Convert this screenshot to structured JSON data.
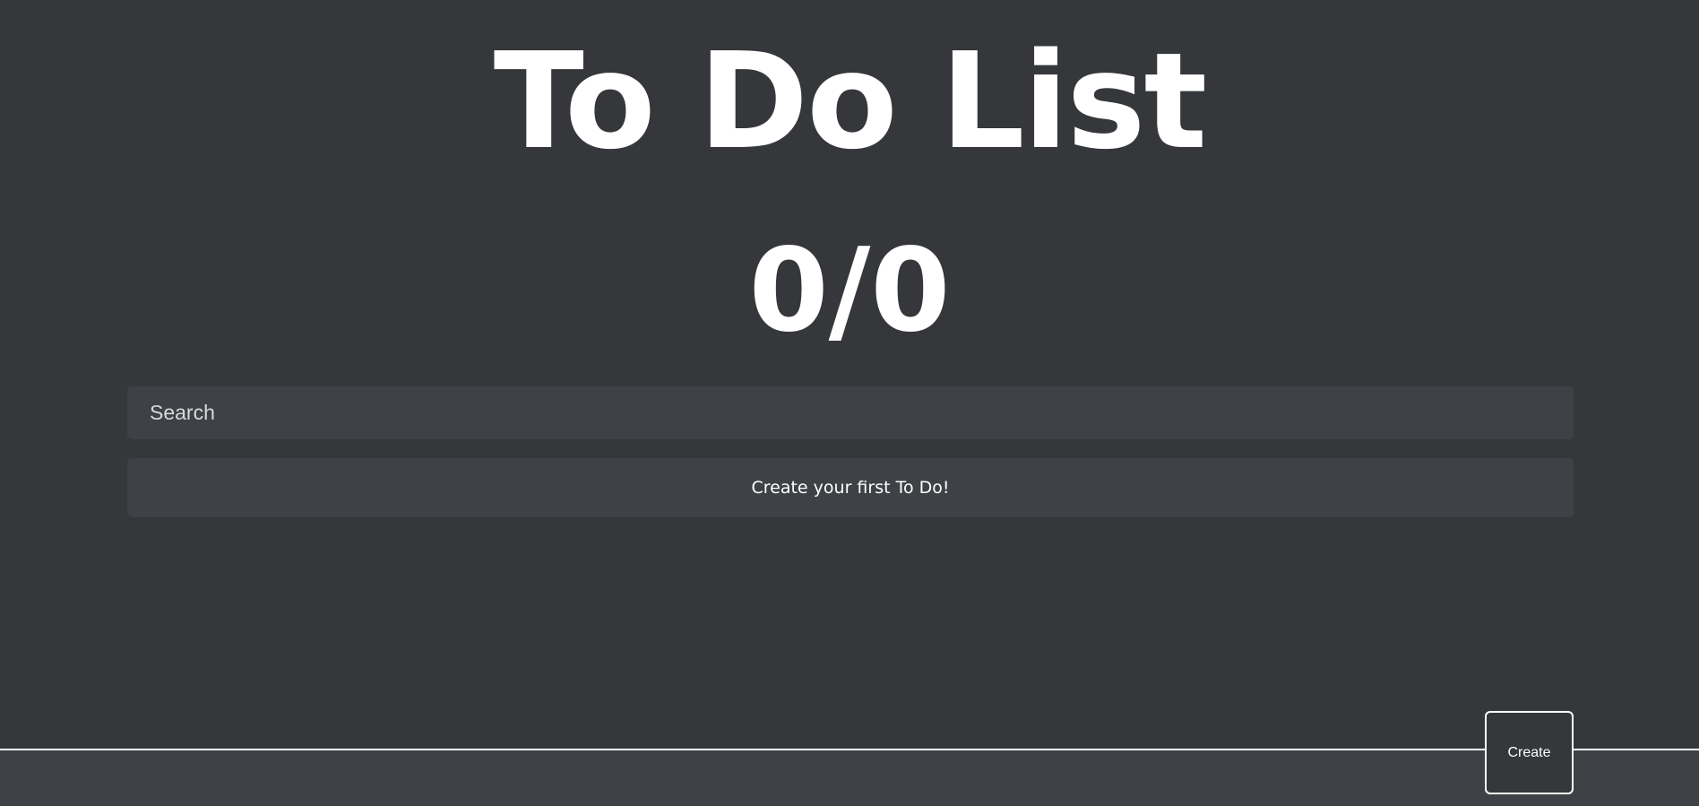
{
  "header": {
    "title": "To Do List",
    "counter": "0/0"
  },
  "search": {
    "placeholder": "Search",
    "value": ""
  },
  "list": {
    "empty_message": "Create your first To Do!"
  },
  "footer": {
    "create_label": "Create"
  },
  "colors": {
    "background": "#35373b",
    "surface": "#3e4145",
    "text": "#ffffff",
    "border": "#ffffff"
  }
}
